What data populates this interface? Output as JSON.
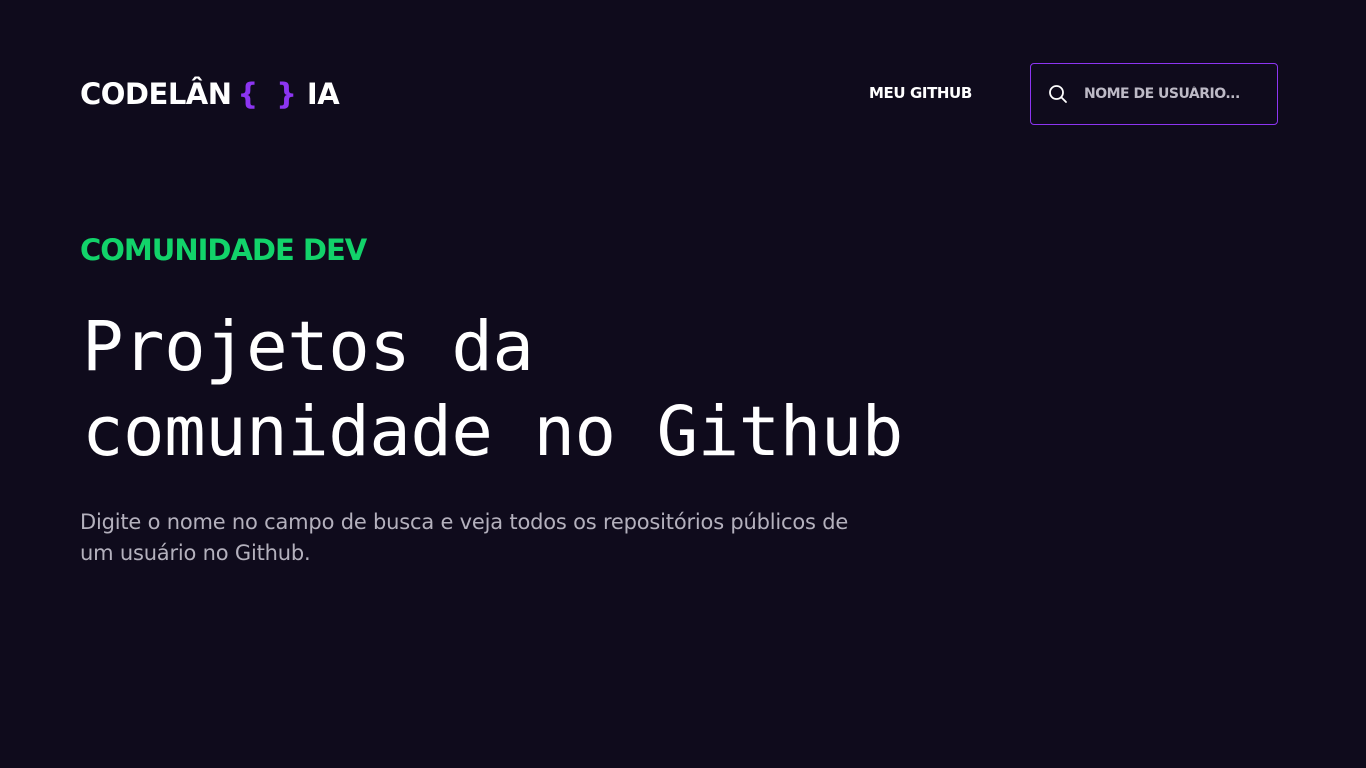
{
  "header": {
    "logo": {
      "text_before": "CODELÂN",
      "braces": "{ }",
      "text_after": "IA"
    },
    "nav": {
      "github_link": "MEU GITHUB"
    },
    "search": {
      "placeholder": "NOME DE USUÁRIO...",
      "value": "",
      "icon": "search-icon"
    }
  },
  "hero": {
    "eyebrow": "COMUNIDADE DEV",
    "headline_line1": "Projetos da",
    "headline_line2": "comunidade no Github",
    "description_line1": "Digite o nome no campo de busca e veja todos os repositórios públicos de",
    "description_line2": "um usuário no Github."
  },
  "colors": {
    "background": "#0f0b1c",
    "accent_purple": "#8c35f1",
    "accent_green": "#12d36a",
    "text_primary": "#ffffff",
    "text_muted": "#b4b1bd"
  }
}
